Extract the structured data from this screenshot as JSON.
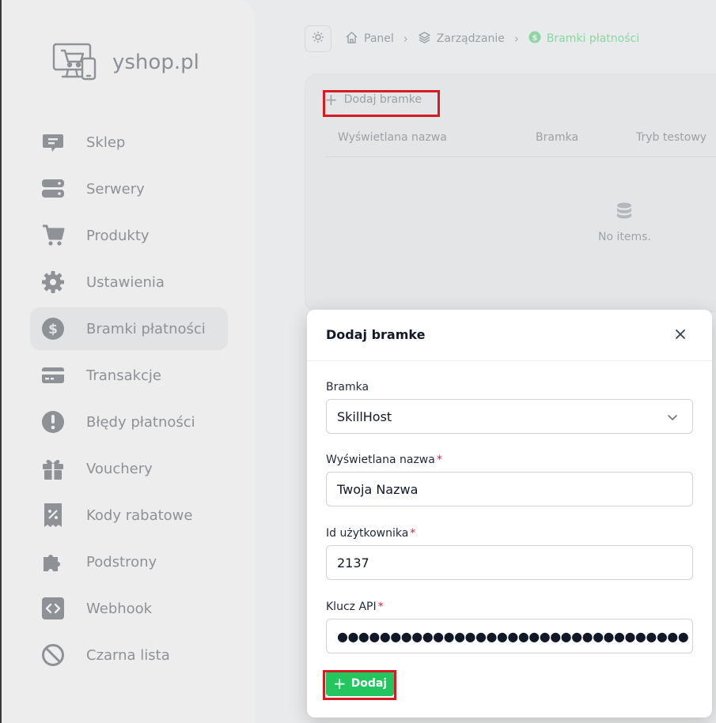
{
  "brand": {
    "name": "yshop.pl"
  },
  "sidebar": {
    "items": [
      {
        "label": "Sklep",
        "icon": "store-icon"
      },
      {
        "label": "Serwery",
        "icon": "servers-icon"
      },
      {
        "label": "Produkty",
        "icon": "cart-icon"
      },
      {
        "label": "Ustawienia",
        "icon": "gear-icon"
      },
      {
        "label": "Bramki płatności",
        "icon": "dollar-icon",
        "active": true
      },
      {
        "label": "Transakcje",
        "icon": "credit-card-icon"
      },
      {
        "label": "Błędy płatności",
        "icon": "alert-icon"
      },
      {
        "label": "Vouchery",
        "icon": "gift-icon"
      },
      {
        "label": "Kody rabatowe",
        "icon": "discount-receipt-icon"
      },
      {
        "label": "Podstrony",
        "icon": "puzzle-icon"
      },
      {
        "label": "Webhook",
        "icon": "code-icon"
      },
      {
        "label": "Czarna lista",
        "icon": "ban-icon"
      }
    ]
  },
  "breadcrumb": {
    "panel": "Panel",
    "management": "Zarządzanie",
    "current": "Bramki płatności"
  },
  "card": {
    "add_button": "Dodaj bramke",
    "columns": [
      "Wyświetlana nazwa",
      "Bramka",
      "Tryb testowy"
    ],
    "empty_text": "No items."
  },
  "modal": {
    "title": "Dodaj bramke",
    "gateway_label": "Bramka",
    "gateway_value": "SkillHost",
    "display_name_label": "Wyświetlana nazwa",
    "display_name_value": "Twoja Nazwa",
    "user_id_label": "Id użytkownika",
    "user_id_value": "2137",
    "api_key_label": "Klucz API",
    "api_key_value": "●●●●●●●●●●●●●●●●●●●●●●●●●●●●●●●●●",
    "required_mark": "*",
    "submit_label": "Dodaj"
  },
  "colors": {
    "accent": "#22c55e",
    "highlight": "#d61b22",
    "required": "#e11d48"
  }
}
